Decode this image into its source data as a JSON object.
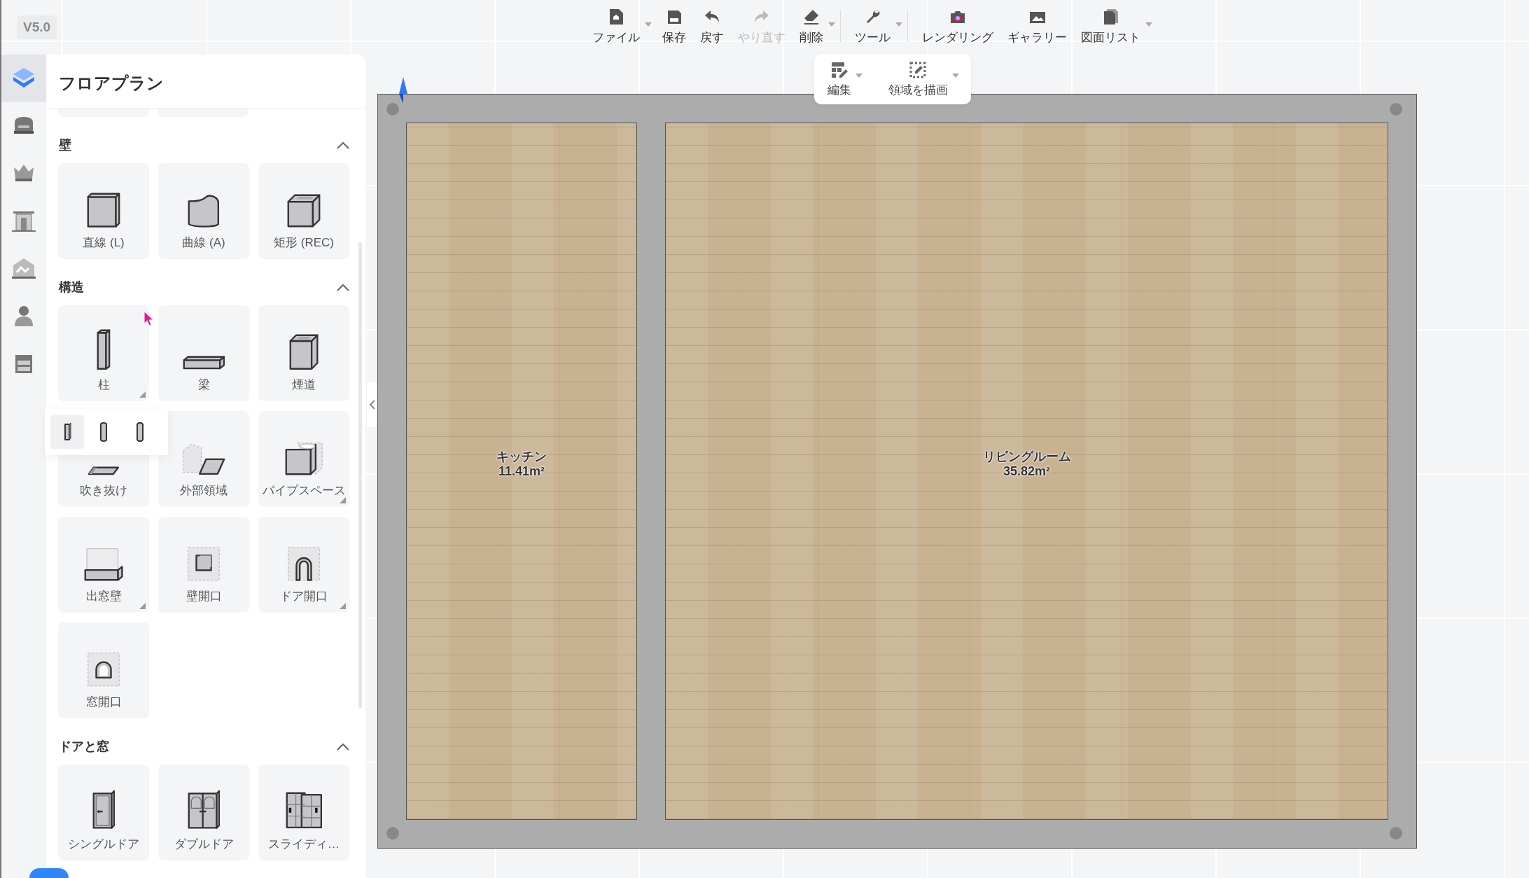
{
  "version": "V5.0",
  "rail": [
    {
      "selected": true
    },
    {
      "selected": false
    },
    {
      "selected": false
    },
    {
      "selected": false
    },
    {
      "selected": false
    },
    {
      "selected": false
    },
    {
      "selected": false
    }
  ],
  "toolbar": [
    {
      "label": "ファイル",
      "dropdown": true,
      "disabled": false,
      "divider_after": false
    },
    {
      "label": "保存",
      "dropdown": false,
      "disabled": false,
      "divider_after": false
    },
    {
      "label": "戻す",
      "dropdown": false,
      "disabled": false,
      "divider_after": false
    },
    {
      "label": "やり直す",
      "dropdown": false,
      "disabled": true,
      "divider_after": false
    },
    {
      "label": "削除",
      "dropdown": true,
      "disabled": false,
      "divider_after": true
    },
    {
      "label": "ツール",
      "dropdown": true,
      "disabled": false,
      "divider_after": true
    },
    {
      "label": "レンダリング",
      "dropdown": false,
      "disabled": false,
      "divider_after": false
    },
    {
      "label": "ギャラリー",
      "dropdown": false,
      "disabled": false,
      "divider_after": false
    },
    {
      "label": "図面リスト",
      "dropdown": true,
      "disabled": false,
      "divider_after": false
    }
  ],
  "subtoolbar": [
    {
      "label": "編集",
      "dropdown": true
    },
    {
      "label": "領域を描画",
      "dropdown": true
    }
  ],
  "panel": {
    "title": "フロアプラン",
    "sections": [
      {
        "title": "壁",
        "expanded": true,
        "items": [
          {
            "label": "直線 (L)",
            "has_variants": false
          },
          {
            "label": "曲線 (A)",
            "has_variants": false
          },
          {
            "label": "矩形 (REC)",
            "has_variants": false
          }
        ]
      },
      {
        "title": "構造",
        "expanded": true,
        "items": [
          {
            "label": "柱",
            "has_variants": true
          },
          {
            "label": "梁",
            "has_variants": false
          },
          {
            "label": "煙道",
            "has_variants": false
          },
          {
            "label": "吹き抜け",
            "has_variants": false
          },
          {
            "label": "外部領域",
            "has_variants": false
          },
          {
            "label": "パイプスペース",
            "has_variants": true
          },
          {
            "label": "出窓壁",
            "has_variants": true
          },
          {
            "label": "壁開口",
            "has_variants": false
          },
          {
            "label": "ドア開口",
            "has_variants": true
          },
          {
            "label": "窓開口",
            "has_variants": false
          }
        ]
      },
      {
        "title": "ドアと窓",
        "expanded": true,
        "items": [
          {
            "label": "シングルドア",
            "has_variants": false
          },
          {
            "label": "ダブルドア",
            "has_variants": false
          },
          {
            "label": "スライディ…",
            "has_variants": false
          }
        ]
      }
    ]
  },
  "flyout": {
    "options": [
      {
        "selected": true
      },
      {
        "selected": false
      },
      {
        "selected": false
      }
    ]
  },
  "floor": {
    "rooms": [
      {
        "name": "キッチン",
        "area": "11.41m²"
      },
      {
        "name": "リビングルーム",
        "area": "35.82m²"
      }
    ]
  }
}
